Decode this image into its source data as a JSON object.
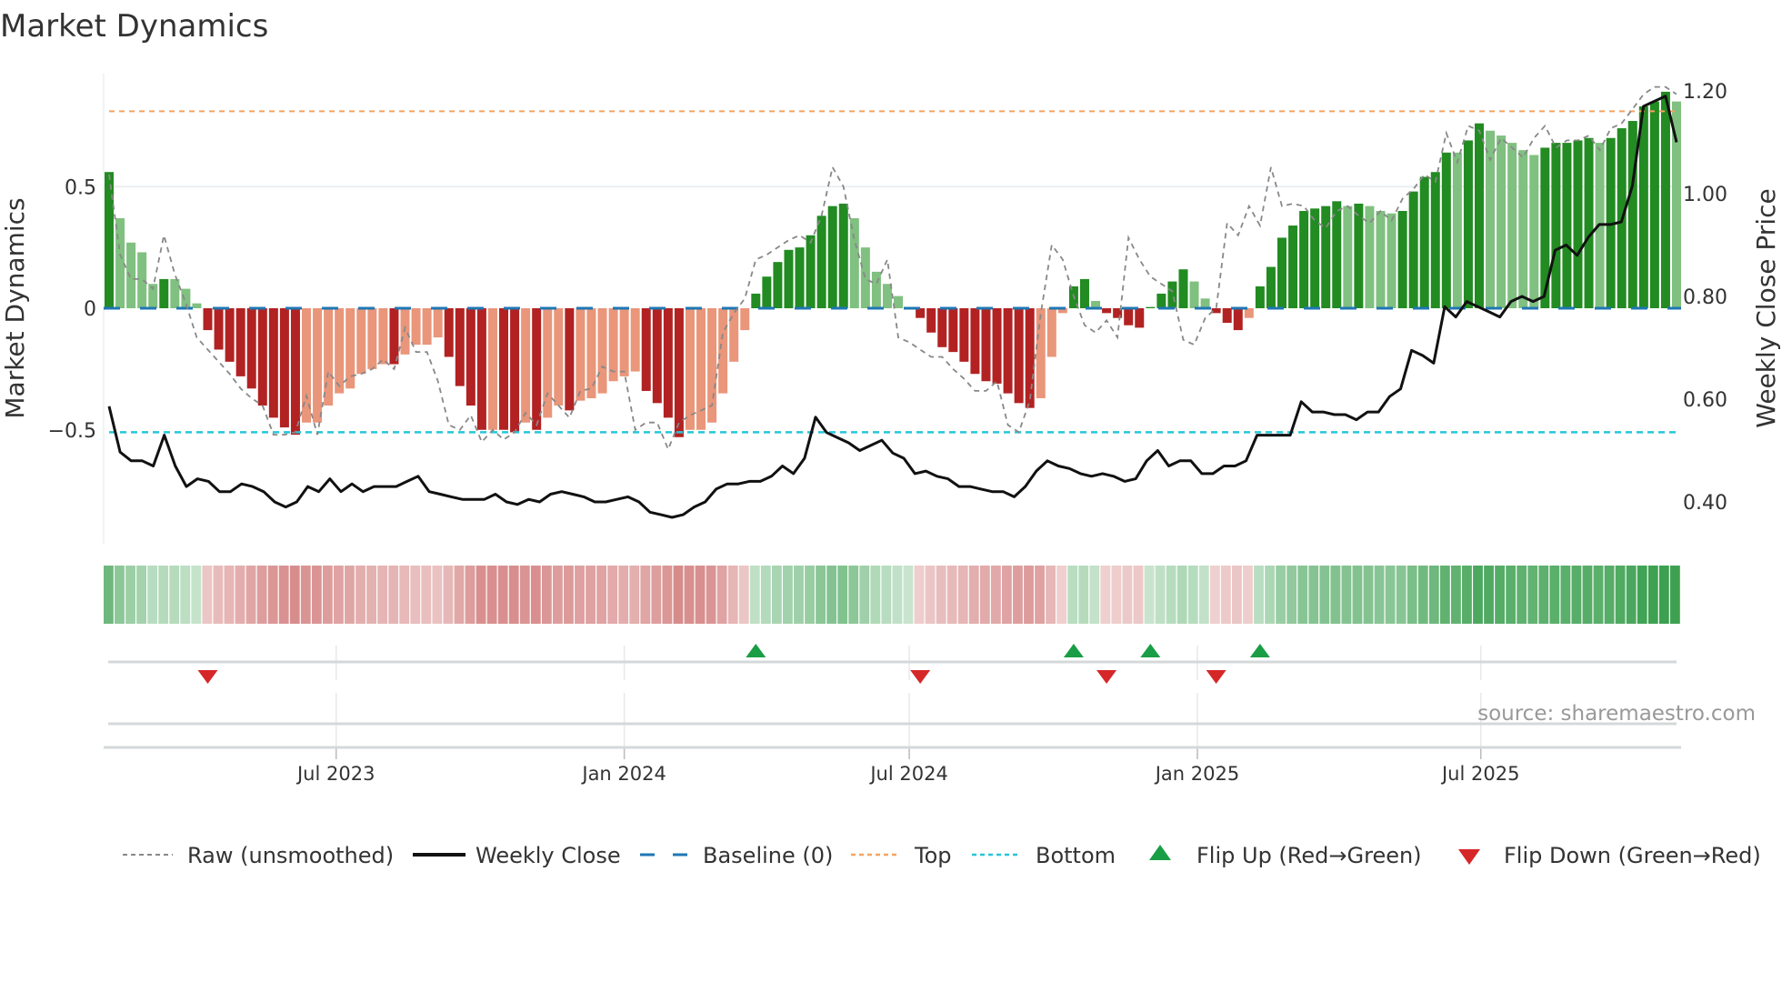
{
  "chart_data": {
    "type": "bar",
    "title": "Market Dynamics",
    "ylabel": "Market Dynamics",
    "y2label": "Weekly Close Price",
    "ylim": [
      -0.95,
      0.99
    ],
    "y2lim": [
      0.31,
      1.23
    ],
    "yticks": [
      {
        "v": 0.5,
        "label": "0.5"
      },
      {
        "v": 0,
        "label": "0"
      },
      {
        "v": -0.5,
        "label": "−0.5"
      }
    ],
    "y2ticks": [
      {
        "v": 0.4,
        "label": "0.40"
      },
      {
        "v": 0.6,
        "label": "0.60"
      },
      {
        "v": 0.8,
        "label": "0.80"
      },
      {
        "v": 1.0,
        "label": "1.00"
      },
      {
        "v": 1.2,
        "label": "1.20"
      }
    ],
    "xticks": [
      {
        "date": "2023-07-01",
        "label": "Jul 2023"
      },
      {
        "date": "2024-01-01",
        "label": "Jan 2024"
      },
      {
        "date": "2024-07-01",
        "label": "Jul 2024"
      },
      {
        "date": "2025-01-01",
        "label": "Jan 2025"
      },
      {
        "date": "2025-07-01",
        "label": "Jul 2025"
      }
    ],
    "start_date": "2023-02-06",
    "end_date": "2025-11-03",
    "frequency": "weekly",
    "top": 0.81,
    "bottom": -0.51,
    "baseline": 0,
    "values": [
      0.56,
      0.37,
      0.27,
      0.23,
      0.1,
      0.12,
      0.12,
      0.08,
      0.02,
      -0.09,
      -0.17,
      -0.22,
      -0.28,
      -0.33,
      -0.4,
      -0.45,
      -0.49,
      -0.52,
      -0.47,
      -0.47,
      -0.4,
      -0.35,
      -0.33,
      -0.27,
      -0.25,
      -0.23,
      -0.23,
      -0.19,
      -0.15,
      -0.15,
      -0.12,
      -0.2,
      -0.32,
      -0.4,
      -0.5,
      -0.5,
      -0.5,
      -0.51,
      -0.47,
      -0.5,
      -0.45,
      -0.4,
      -0.42,
      -0.38,
      -0.37,
      -0.35,
      -0.3,
      -0.28,
      -0.26,
      -0.34,
      -0.39,
      -0.45,
      -0.53,
      -0.5,
      -0.5,
      -0.47,
      -0.35,
      -0.22,
      -0.09,
      0.06,
      0.13,
      0.19,
      0.24,
      0.25,
      0.3,
      0.38,
      0.42,
      0.43,
      0.37,
      0.25,
      0.15,
      0.1,
      0.05,
      0.005,
      -0.04,
      -0.1,
      -0.16,
      -0.18,
      -0.22,
      -0.27,
      -0.3,
      -0.31,
      -0.35,
      -0.39,
      -0.41,
      -0.37,
      -0.2,
      -0.02,
      0.09,
      0.12,
      0.03,
      -0.02,
      -0.04,
      -0.07,
      -0.08,
      0.005,
      0.06,
      0.11,
      0.16,
      0.11,
      0.04,
      -0.02,
      -0.06,
      -0.09,
      -0.04,
      0.09,
      0.17,
      0.29,
      0.34,
      0.4,
      0.41,
      0.42,
      0.44,
      0.42,
      0.43,
      0.42,
      0.4,
      0.39,
      0.4,
      0.48,
      0.54,
      0.56,
      0.64,
      0.64,
      0.69,
      0.76,
      0.73,
      0.71,
      0.68,
      0.65,
      0.63,
      0.66,
      0.68,
      0.68,
      0.69,
      0.7,
      0.68,
      0.7,
      0.74,
      0.77,
      0.83,
      0.85,
      0.89,
      0.85
    ],
    "strong": [
      1,
      0,
      0,
      0,
      0,
      1,
      0,
      0,
      0,
      1,
      1,
      1,
      1,
      1,
      1,
      1,
      1,
      1,
      0,
      0,
      0,
      0,
      0,
      0,
      0,
      0,
      1,
      0,
      0,
      0,
      0,
      1,
      1,
      1,
      1,
      0,
      1,
      1,
      0,
      1,
      0,
      0,
      1,
      0,
      0,
      0,
      0,
      0,
      0,
      1,
      1,
      1,
      1,
      0,
      0,
      0,
      0,
      0,
      0,
      1,
      1,
      1,
      1,
      1,
      1,
      1,
      1,
      1,
      0,
      0,
      0,
      0,
      0,
      0,
      1,
      1,
      1,
      1,
      1,
      1,
      1,
      1,
      1,
      1,
      1,
      0,
      0,
      0,
      1,
      1,
      0,
      1,
      1,
      1,
      1,
      1,
      1,
      1,
      1,
      0,
      0,
      1,
      1,
      1,
      0,
      1,
      1,
      1,
      1,
      1,
      1,
      1,
      1,
      0,
      1,
      0,
      0,
      0,
      1,
      1,
      1,
      1,
      1,
      0,
      1,
      1,
      0,
      0,
      0,
      0,
      0,
      1,
      1,
      1,
      1,
      1,
      0,
      1,
      1,
      1,
      1,
      1,
      1,
      0
    ],
    "raw": [
      0.55,
      0.22,
      0.12,
      0.12,
      0.08,
      0.3,
      0.14,
      0.02,
      -0.12,
      -0.17,
      -0.22,
      -0.27,
      -0.33,
      -0.37,
      -0.4,
      -0.52,
      -0.52,
      -0.51,
      -0.36,
      -0.52,
      -0.26,
      -0.32,
      -0.28,
      -0.27,
      -0.25,
      -0.21,
      -0.25,
      -0.08,
      -0.18,
      -0.18,
      -0.3,
      -0.48,
      -0.5,
      -0.44,
      -0.55,
      -0.5,
      -0.54,
      -0.51,
      -0.43,
      -0.48,
      -0.35,
      -0.4,
      -0.45,
      -0.34,
      -0.33,
      -0.24,
      -0.26,
      -0.26,
      -0.5,
      -0.47,
      -0.47,
      -0.58,
      -0.47,
      -0.44,
      -0.42,
      -0.4,
      -0.1,
      -0.02,
      0.04,
      0.2,
      0.22,
      0.25,
      0.28,
      0.3,
      0.27,
      0.38,
      0.58,
      0.5,
      0.28,
      0.12,
      0.1,
      0.2,
      -0.12,
      -0.14,
      -0.17,
      -0.2,
      -0.2,
      -0.25,
      -0.29,
      -0.34,
      -0.34,
      -0.3,
      -0.48,
      -0.51,
      -0.38,
      -0.02,
      0.26,
      0.2,
      0.05,
      -0.07,
      -0.1,
      -0.05,
      -0.12,
      0.29,
      0.2,
      0.13,
      0.1,
      0.07,
      -0.13,
      -0.15,
      -0.04,
      0.0,
      0.35,
      0.3,
      0.42,
      0.34,
      0.58,
      0.42,
      0.43,
      0.42,
      0.36,
      0.33,
      0.4,
      0.42,
      0.38,
      0.35,
      0.4,
      0.36,
      0.45,
      0.49,
      0.55,
      0.52,
      0.72,
      0.6,
      0.75,
      0.73,
      0.61,
      0.7,
      0.66,
      0.62,
      0.7,
      0.75,
      0.66,
      0.69,
      0.69,
      0.71,
      0.65,
      0.74,
      0.76,
      0.82,
      0.88,
      0.91,
      0.91,
      0.88
    ],
    "close": [
      0.586,
      0.497,
      0.48,
      0.48,
      0.47,
      0.53,
      0.47,
      0.43,
      0.445,
      0.44,
      0.42,
      0.42,
      0.435,
      0.43,
      0.42,
      0.4,
      0.39,
      0.4,
      0.43,
      0.42,
      0.445,
      0.42,
      0.435,
      0.42,
      0.43,
      0.43,
      0.43,
      0.44,
      0.45,
      0.42,
      0.415,
      0.41,
      0.405,
      0.405,
      0.405,
      0.415,
      0.4,
      0.395,
      0.405,
      0.4,
      0.415,
      0.42,
      0.415,
      0.41,
      0.4,
      0.4,
      0.405,
      0.41,
      0.4,
      0.38,
      0.375,
      0.37,
      0.375,
      0.39,
      0.4,
      0.425,
      0.435,
      0.435,
      0.44,
      0.44,
      0.45,
      0.47,
      0.455,
      0.485,
      0.565,
      0.535,
      0.525,
      0.515,
      0.5,
      0.51,
      0.52,
      0.495,
      0.485,
      0.455,
      0.46,
      0.45,
      0.445,
      0.43,
      0.43,
      0.425,
      0.42,
      0.42,
      0.41,
      0.43,
      0.46,
      0.48,
      0.47,
      0.465,
      0.455,
      0.45,
      0.455,
      0.45,
      0.44,
      0.445,
      0.48,
      0.5,
      0.47,
      0.48,
      0.48,
      0.455,
      0.455,
      0.47,
      0.47,
      0.48,
      0.53,
      0.53,
      0.53,
      0.53,
      0.595,
      0.575,
      0.575,
      0.57,
      0.57,
      0.56,
      0.575,
      0.575,
      0.605,
      0.62,
      0.695,
      0.685,
      0.67,
      0.78,
      0.76,
      0.79,
      0.78,
      0.77,
      0.76,
      0.79,
      0.8,
      0.79,
      0.8,
      0.89,
      0.9,
      0.88,
      0.915,
      0.94,
      0.94,
      0.945,
      1.015,
      1.17,
      1.18,
      1.19,
      1.1
    ],
    "flips_up": [
      "2024-03-25",
      "2024-10-14",
      "2024-12-02",
      "2025-02-10"
    ],
    "flips_down": [
      "2023-04-10",
      "2024-07-08",
      "2024-11-04",
      "2025-01-13"
    ],
    "legend": [
      {
        "label": "Raw (unsmoothed)",
        "key": "raw"
      },
      {
        "label": "Weekly Close",
        "key": "close"
      },
      {
        "label": "Baseline (0)",
        "key": "baseline"
      },
      {
        "label": "Top",
        "key": "top"
      },
      {
        "label": "Bottom",
        "key": "bottom"
      },
      {
        "label": "Flip Up (Red→Green)",
        "key": "up"
      },
      {
        "label": "Flip Down (Green→Red)",
        "key": "down"
      }
    ],
    "source": "source: sharemaestro.com"
  },
  "colors": {
    "strong_pos": "#228b22",
    "weak_pos": "#80c080",
    "strong_neg": "#b22222",
    "weak_neg": "#e9967a",
    "top": "#f4a460",
    "bottom": "#26c6da",
    "baseline": "#1f77b4",
    "up": "#1a9e45",
    "down": "#d62728"
  }
}
